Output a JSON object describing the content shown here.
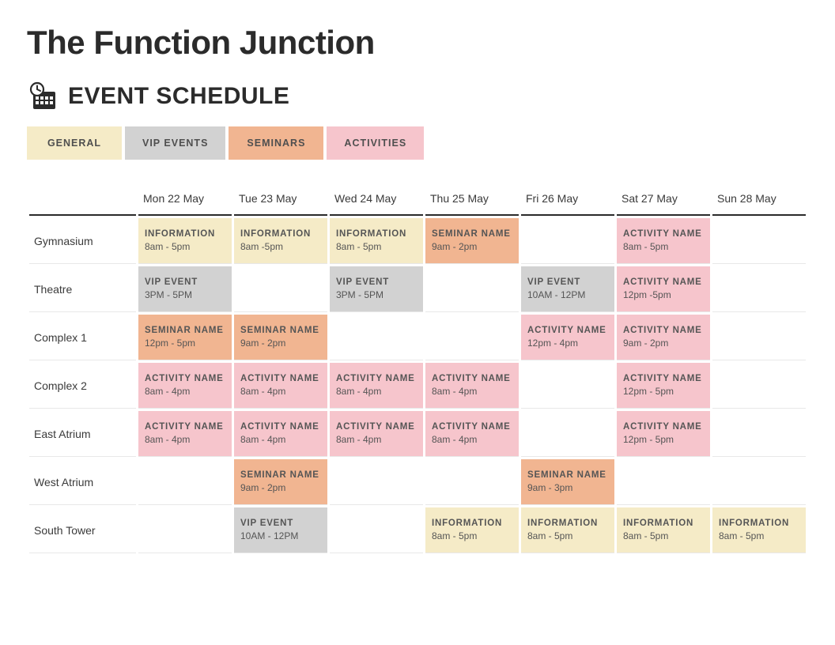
{
  "title": "The Function Junction",
  "schedule_label": "EVENT SCHEDULE",
  "tabs": {
    "general": "GENERAL",
    "vip": "VIP EVENTS",
    "seminar": "SEMINARS",
    "activity": "ACTIVITIES"
  },
  "days": [
    "Mon 22 May",
    "Tue 23 May",
    "Wed 24 May",
    "Thu 25 May",
    "Fri 26 May",
    "Sat 27 May",
    "Sun 28 May"
  ],
  "rooms": [
    "Gymnasium",
    "Theatre",
    "Complex 1",
    "Complex 2",
    "East Atrium",
    "West Atrium",
    "South Tower"
  ],
  "grid": [
    [
      {
        "type": "general",
        "title": "INFORMATION",
        "time": "8am - 5pm"
      },
      {
        "type": "general",
        "title": "INFORMATION",
        "time": "8am -5pm"
      },
      {
        "type": "general",
        "title": "INFORMATION",
        "time": "8am - 5pm"
      },
      {
        "type": "seminar",
        "title": "SEMINAR NAME",
        "time": "9am - 2pm"
      },
      null,
      {
        "type": "activity",
        "title": "ACTIVITY NAME",
        "time": "8am - 5pm"
      },
      null
    ],
    [
      {
        "type": "vip",
        "title": "VIP EVENT",
        "time": "3PM - 5PM"
      },
      null,
      {
        "type": "vip",
        "title": "VIP EVENT",
        "time": "3PM - 5PM"
      },
      null,
      {
        "type": "vip",
        "title": "VIP EVENT",
        "time": "10AM - 12PM"
      },
      {
        "type": "activity",
        "title": "ACTIVITY NAME",
        "time": "12pm -5pm"
      },
      null
    ],
    [
      {
        "type": "seminar",
        "title": "SEMINAR NAME",
        "time": "12pm - 5pm"
      },
      {
        "type": "seminar",
        "title": "SEMINAR NAME",
        "time": "9am - 2pm"
      },
      null,
      null,
      {
        "type": "activity",
        "title": "ACTIVITY NAME",
        "time": "12pm - 4pm"
      },
      {
        "type": "activity",
        "title": "ACTIVITY NAME",
        "time": "9am - 2pm"
      },
      null
    ],
    [
      {
        "type": "activity",
        "title": "ACTIVITY NAME",
        "time": "8am - 4pm"
      },
      {
        "type": "activity",
        "title": "ACTIVITY NAME",
        "time": "8am - 4pm"
      },
      {
        "type": "activity",
        "title": "ACTIVITY NAME",
        "time": "8am - 4pm"
      },
      {
        "type": "activity",
        "title": "ACTIVITY NAME",
        "time": "8am - 4pm"
      },
      null,
      {
        "type": "activity",
        "title": "ACTIVITY NAME",
        "time": "12pm - 5pm"
      },
      null
    ],
    [
      {
        "type": "activity",
        "title": "ACTIVITY NAME",
        "time": "8am - 4pm"
      },
      {
        "type": "activity",
        "title": "ACTIVITY NAME",
        "time": "8am - 4pm"
      },
      {
        "type": "activity",
        "title": "ACTIVITY NAME",
        "time": "8am - 4pm"
      },
      {
        "type": "activity",
        "title": "ACTIVITY NAME",
        "time": "8am - 4pm"
      },
      null,
      {
        "type": "activity",
        "title": "ACTIVITY NAME",
        "time": "12pm - 5pm"
      },
      null
    ],
    [
      null,
      {
        "type": "seminar",
        "title": "SEMINAR NAME",
        "time": "9am - 2pm"
      },
      null,
      null,
      {
        "type": "seminar",
        "title": "SEMINAR NAME",
        "time": "9am - 3pm"
      },
      null,
      null
    ],
    [
      null,
      {
        "type": "vip",
        "title": "VIP EVENT",
        "time": "10AM - 12PM"
      },
      null,
      {
        "type": "general",
        "title": "INFORMATION",
        "time": "8am - 5pm"
      },
      {
        "type": "general",
        "title": "INFORMATION",
        "time": "8am - 5pm"
      },
      {
        "type": "general",
        "title": "INFORMATION",
        "time": "8am - 5pm"
      },
      {
        "type": "general",
        "title": "INFORMATION",
        "time": "8am - 5pm"
      }
    ]
  ]
}
